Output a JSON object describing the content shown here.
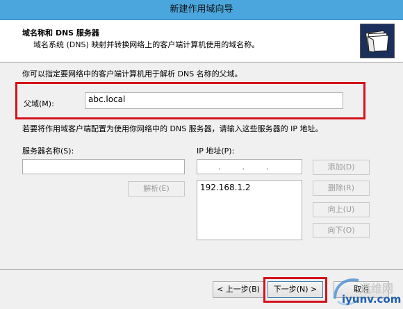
{
  "window": {
    "title": "新建作用域向导"
  },
  "header": {
    "title": "域名称和 DNS 服务器",
    "description": "域名系统 (DNS) 映射并转换网络上的客户端计算机使用的域名称。"
  },
  "instructions": {
    "intro": "你可以指定要网络中的客户端计算机用于解析 DNS 名称的父域。",
    "dns_servers": "若要将作用域客户端配置为使用你网络中的 DNS 服务器，请输入这些服务器的 IP 地址。"
  },
  "parent_domain": {
    "label": "父域(M):",
    "value": "abc.local"
  },
  "server_name": {
    "label": "服务器名称(S):",
    "value": ""
  },
  "ip_address": {
    "label": "IP 地址(P):",
    "placeholder": ".        .        ."
  },
  "buttons": {
    "resolve": "解析(E)",
    "add": "添加(D)",
    "remove": "删除(R)",
    "up": "向上(U)",
    "down": "向下(O)",
    "back": "< 上一步(B)",
    "next": "下一步(N) >",
    "cancel": "取消"
  },
  "ip_list": [
    "192.168.1.2"
  ],
  "watermark": {
    "line1": "运维网",
    "line2": "iyunv.com"
  },
  "colors": {
    "titlebar": "#4aa6dc",
    "highlight": "#d4121a"
  }
}
